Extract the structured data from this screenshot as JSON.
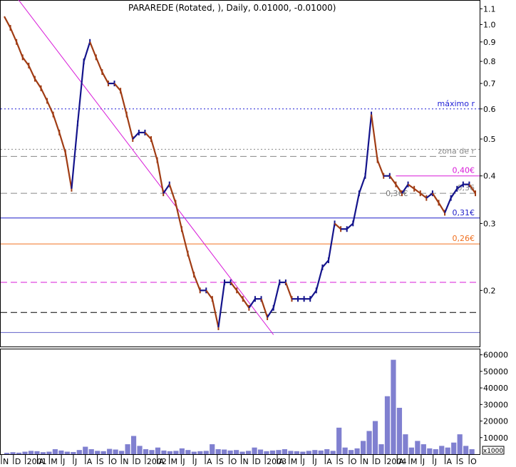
{
  "chart_data": [
    {
      "type": "line",
      "title": "PARAREDE",
      "subtitle": "(Rotated, ), Daily, 0.01000, -0.01000)",
      "y_scale": "log",
      "ylim": [
        0.15,
        1.15
      ],
      "y_ticks": [
        "1.1",
        "1.0",
        "0.9",
        "0.8",
        "0.7",
        "0.6",
        "0.5",
        "0.4",
        "0.3",
        "0.2"
      ],
      "y_tick_values": [
        1.1,
        1.0,
        0.9,
        0.8,
        0.7,
        0.6,
        0.5,
        0.4,
        0.3,
        0.2
      ],
      "grid": false,
      "horizontal_lines": [
        {
          "value": 0.6,
          "color": "#1d1dd6",
          "style": "dotted",
          "label": "máximo r"
        },
        {
          "value": 0.47,
          "color": "#888888",
          "style": "dotted",
          "label": ""
        },
        {
          "value": 0.45,
          "color": "#888888",
          "style": "dashed",
          "label": "zona de r"
        },
        {
          "value": 0.4,
          "color": "#d81ad8",
          "style": "solid",
          "label": "0,40€",
          "x_start_index": 64
        },
        {
          "value": 0.36,
          "color": "#888888",
          "style": "dashed",
          "label": "0,36"
        },
        {
          "value": 0.31,
          "color": "#1d1dc8",
          "style": "solid",
          "label": "0,31€"
        },
        {
          "value": 0.265,
          "color": "#f07020",
          "style": "solid",
          "label": "0,26€"
        },
        {
          "value": 0.21,
          "color": "#d81ad8",
          "style": "dashed",
          "label": ""
        },
        {
          "value": 0.175,
          "color": "#000000",
          "style": "dashed",
          "label": ""
        },
        {
          "value": 0.155,
          "color": "#6060c8",
          "style": "solid",
          "label": ""
        }
      ],
      "inline_labels": [
        {
          "text": "0,36€",
          "value": 0.36,
          "x_index": 66
        }
      ],
      "trendline": {
        "from": [
          0,
          1.3
        ],
        "to": [
          44,
          0.153
        ],
        "color": "#d81ad8"
      },
      "series": [
        {
          "values": [
            1.05,
            0.98,
            0.9,
            0.82,
            0.78,
            0.72,
            0.68,
            0.63,
            0.58,
            0.52,
            0.46,
            0.37,
            0.55,
            0.8,
            0.9,
            0.82,
            0.75,
            0.7,
            0.7,
            0.67,
            0.58,
            0.5,
            0.52,
            0.52,
            0.5,
            0.44,
            0.36,
            0.38,
            0.34,
            0.29,
            0.25,
            0.22,
            0.2,
            0.2,
            0.19,
            0.16,
            0.21,
            0.21,
            0.2,
            0.19,
            0.18,
            0.19,
            0.19,
            0.17,
            0.18,
            0.21,
            0.21,
            0.19,
            0.19,
            0.19,
            0.19,
            0.2,
            0.23,
            0.24,
            0.3,
            0.29,
            0.29,
            0.3,
            0.36,
            0.4,
            0.58,
            0.44,
            0.4,
            0.4,
            0.38,
            0.36,
            0.38,
            0.37,
            0.36,
            0.35,
            0.36,
            0.34,
            0.32,
            0.35,
            0.37,
            0.38,
            0.38,
            0.36
          ]
        }
      ]
    },
    {
      "type": "bar",
      "title": "",
      "ylim": [
        0,
        62000
      ],
      "y_ticks": [
        "60000",
        "50000",
        "40000",
        "30000",
        "20000",
        "10000"
      ],
      "y_tick_values": [
        60000,
        50000,
        40000,
        30000,
        20000,
        10000
      ],
      "y_unit": "x1000",
      "x_ticks": [
        "N",
        "D",
        "2001",
        "A",
        "M",
        "J",
        "J",
        "A",
        "S",
        "O",
        "N",
        "D",
        "2002",
        "A",
        "M",
        "J",
        "J",
        "A",
        "S",
        "O",
        "N",
        "D",
        "2003",
        "A",
        "M",
        "J",
        "J",
        "A",
        "S",
        "O",
        "N",
        "D",
        "2004",
        "A",
        "M",
        "J",
        "J",
        "A",
        "S",
        "O"
      ],
      "values": [
        800,
        1200,
        900,
        1500,
        2000,
        1800,
        1200,
        1500,
        3000,
        2200,
        1500,
        1300,
        2500,
        4500,
        3000,
        2000,
        1800,
        3200,
        2800,
        2000,
        6000,
        11000,
        5000,
        3000,
        2500,
        4000,
        2200,
        1800,
        2000,
        3500,
        2500,
        1500,
        1800,
        2000,
        6000,
        3000,
        2800,
        2200,
        2500,
        1500,
        2000,
        4000,
        2800,
        1800,
        2200,
        2500,
        3000,
        2000,
        1800,
        1500,
        2000,
        2500,
        2200,
        3000,
        2000,
        16000,
        4000,
        2500,
        3500,
        8000,
        14000,
        20000,
        6000,
        35000,
        57000,
        28000,
        12000,
        4000,
        8000,
        6000,
        3500,
        3000,
        5000,
        4000,
        7000,
        12000,
        5000,
        3000
      ]
    }
  ]
}
